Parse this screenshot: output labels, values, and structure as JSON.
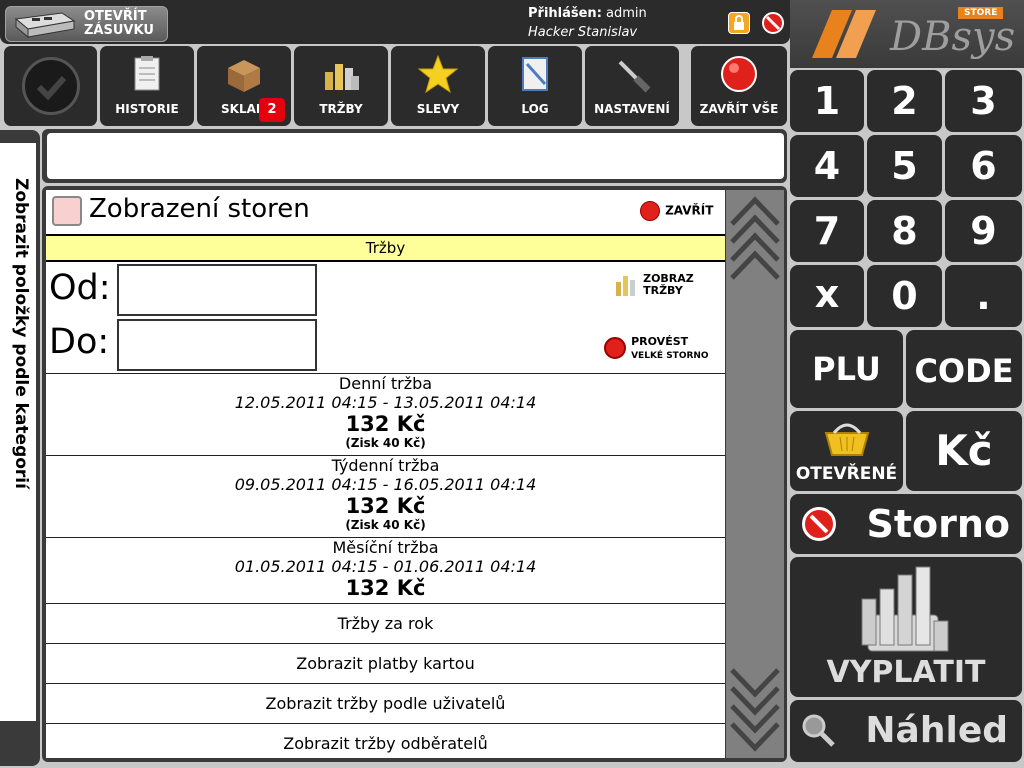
{
  "topbar": {
    "drawer_label_1": "OTEVŘÍT",
    "drawer_label_2": "ZÁSUVKU",
    "login_label": "Přihlášen:",
    "login_user": "admin",
    "login_name": "Hacker Stanislav"
  },
  "logo": {
    "text": "DBsys",
    "badge": "STORE"
  },
  "toolbar": [
    {
      "label": "HISTORIE",
      "icon": "history-icon"
    },
    {
      "label": "SKLAD",
      "icon": "warehouse-icon",
      "badge": "2"
    },
    {
      "label": "TRŽBY",
      "icon": "coins-icon"
    },
    {
      "label": "SLEVY",
      "icon": "star-icon"
    },
    {
      "label": "LOG",
      "icon": "log-icon"
    },
    {
      "label": "NASTAVENÍ",
      "icon": "screwdriver-icon"
    },
    {
      "label": "ZAVŘÍT VŠE",
      "icon": "red-circle-icon"
    }
  ],
  "side": {
    "label": "Zobrazit položky podle kategorií"
  },
  "search": {
    "value": "",
    "placeholder": ""
  },
  "panel": {
    "title": "Zobrazení storen",
    "close_label": "ZAVŘÍT",
    "section": "Tržby",
    "from_label": "Od:",
    "to_label": "Do:",
    "show_btn_1": "ZOBRAZ",
    "show_btn_2": "TRŽBY",
    "storno_btn_1": "PROVÉST",
    "storno_btn_2": "VELKÉ STORNO",
    "rows": [
      {
        "title": "Denní tržba",
        "range": "12.05.2011 04:15 - 13.05.2011 04:14",
        "amount": "132 Kč",
        "profit": "(Zisk 40 Kč)"
      },
      {
        "title": "Týdenní tržba",
        "range": "09.05.2011 04:15 - 16.05.2011 04:14",
        "amount": "132 Kč",
        "profit": "(Zisk 40 Kč)"
      },
      {
        "title": "Měsíční tržba",
        "range": "01.05.2011 04:15 - 01.06.2011 04:14",
        "amount": "132 Kč"
      }
    ],
    "links": [
      "Tržby za rok",
      "Zobrazit platby kartou",
      "Zobrazit tržby podle uživatelů",
      "Zobrazit tržby odběratelů"
    ]
  },
  "keypad": {
    "digits": [
      "1",
      "2",
      "3",
      "4",
      "5",
      "6",
      "7",
      "8",
      "9",
      "x",
      "0",
      "."
    ],
    "plu": "PLU",
    "code": "CODE",
    "open_label": "OTEVŘENÉ",
    "currency": "Kč",
    "storno": "Storno",
    "pay": "VYPLATIT",
    "preview": "Náhled"
  },
  "colors": {
    "dark": "#2b2b2b",
    "accent_orange": "#e8821c",
    "section_yellow": "#ffff99",
    "red": "#e0201b"
  }
}
